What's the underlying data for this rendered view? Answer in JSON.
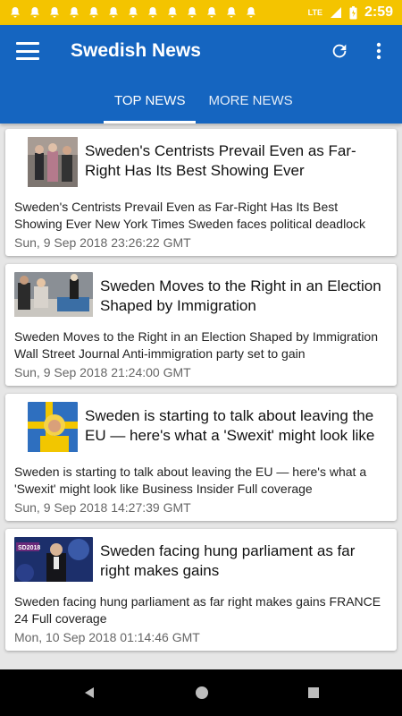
{
  "status_bar": {
    "time": "2:59",
    "network": "LTE",
    "notification_icon": "bell-icon",
    "notification_count": 13
  },
  "app_bar": {
    "title": "Swedish News",
    "menu_icon": "hamburger-menu-icon",
    "refresh_icon": "refresh-icon",
    "overflow_icon": "more-vert-icon",
    "color": "#1565c0"
  },
  "tabs": [
    {
      "label": "TOP NEWS",
      "active": true
    },
    {
      "label": "MORE NEWS",
      "active": false
    }
  ],
  "articles": [
    {
      "headline": "Sweden's Centrists Prevail Even as Far-Right Has Its Best Showing Ever",
      "snippet": "Sweden's Centrists Prevail Even as Far-Right Has Its Best Showing Ever  New York Times  Sweden faces political deadlock",
      "date": "Sun, 9 Sep 2018 23:26:22 GMT"
    },
    {
      "headline": "Sweden Moves to the Right in an Election Shaped by Immigration",
      "snippet": "Sweden Moves to the Right in an Election Shaped by Immigration  Wall Street Journal  Anti-immigration party set to gain",
      "date": "Sun, 9 Sep 2018 21:24:00 GMT"
    },
    {
      "headline": "Sweden is starting to talk about leaving the EU — here's what a 'Swexit' might look like",
      "snippet": "Sweden is starting to talk about leaving the EU — here's what a 'Swexit' might look like  Business Insider  Full coverage",
      "date": "Sun, 9 Sep 2018 14:27:39 GMT"
    },
    {
      "headline": "Sweden facing hung parliament as far right makes gains",
      "snippet": "Sweden facing hung parliament as far right makes gains FRANCE 24  Full coverage",
      "date": "Mon, 10 Sep 2018 01:14:46 GMT",
      "thumb_text": "SD2018"
    }
  ],
  "nav_bar": {
    "back_icon": "back-triangle-icon",
    "home_icon": "home-circle-icon",
    "recents_icon": "recents-square-icon"
  }
}
